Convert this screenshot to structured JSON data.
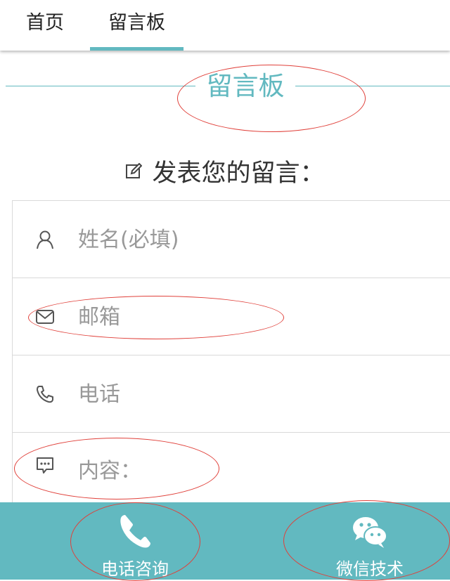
{
  "nav": {
    "tabs": [
      {
        "label": "首页",
        "active": false
      },
      {
        "label": "留言板",
        "active": true
      }
    ]
  },
  "section": {
    "title": "留言板"
  },
  "form": {
    "heading": "发表您的留言：",
    "fields": {
      "name": {
        "placeholder": "姓名(必填)",
        "icon": "user-icon"
      },
      "email": {
        "placeholder": "邮箱",
        "icon": "mail-icon"
      },
      "phone": {
        "placeholder": "电话",
        "icon": "phone-icon"
      },
      "content": {
        "placeholder": "内容：",
        "icon": "message-icon"
      }
    }
  },
  "bottom_bar": {
    "phone_label": "电话咨询",
    "wechat_label": "微信技术"
  },
  "colors": {
    "accent": "#62b9c0",
    "annotation": "#e0403a"
  }
}
